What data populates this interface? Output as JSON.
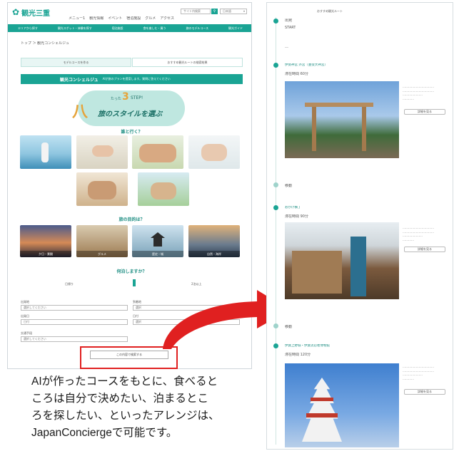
{
  "left_page": {
    "logo_text": "観光三重",
    "search_placeholder": "サイト内検索",
    "lang": "日本語",
    "topnav": [
      "メニュー1",
      "観光情報",
      "イベント",
      "宿泊施設",
      "グルメ",
      "アクセス"
    ],
    "greennav": [
      "エリアから探す",
      "観光スポット・体験を探す",
      "宿泊施設",
      "食を楽しむ・買う",
      "旅のモデルコース",
      "観光ガイド"
    ],
    "breadcrumb": "トップ ＞ 観光コンシェルジュ",
    "tabs": [
      "モデルコースを作る",
      "おすすめ観光ルートの検索結果"
    ],
    "banner_title": "観光コンシェルジュ",
    "banner_sub": "AIが旅のプランを提案します。質問に答えてください",
    "hero_small": "たった",
    "hero_num": "3",
    "hero_step": "STEP!",
    "hero_main": "旅のスタイルを選ぶ",
    "q1": "誰と行く？",
    "q2": "旅の目的は？",
    "q3": "何泊しますか？",
    "purpose_caps": [
      "夕日・景観",
      "グルメ",
      "歴史・城",
      "自然・海岸"
    ],
    "stay_options": [
      "日帰り",
      "1泊",
      "2泊以上"
    ],
    "form_labels": [
      "出発地",
      "到着地",
      "出発日",
      "日付",
      "交通手段"
    ],
    "form_values": [
      "選択してください",
      "選択",
      "日付",
      "選択",
      "選択してください"
    ],
    "submit_label": "この内容で検索する",
    "accent": "#1aa494",
    "highlight": "#e02020"
  },
  "caption": {
    "lines": [
      "AIが作ったコースをもとに、食べると",
      "ころは自分で決めたい、泊まるとこ",
      "ろを探したい、といったアレンジは、",
      "JapanConciergeで可能です。"
    ]
  },
  "right_page": {
    "header_text": "おすすめ観光ルート",
    "start_label": "出発",
    "start_sub": "START",
    "sections": [
      {
        "title": "伊勢神宮 外宮（豊受大神宮）",
        "sub": "滞在時間 60分",
        "button": "詳細を見る"
      },
      {
        "title": "おかげ横丁",
        "sub": "滞在時間 90分",
        "button": "詳細を見る"
      },
      {
        "title": "伊賀上野城・伊賀流忍者博物館",
        "sub": "滞在時間 120分",
        "button": "詳細を見る"
      }
    ],
    "transfer_labels": [
      "移動",
      "移動"
    ]
  }
}
